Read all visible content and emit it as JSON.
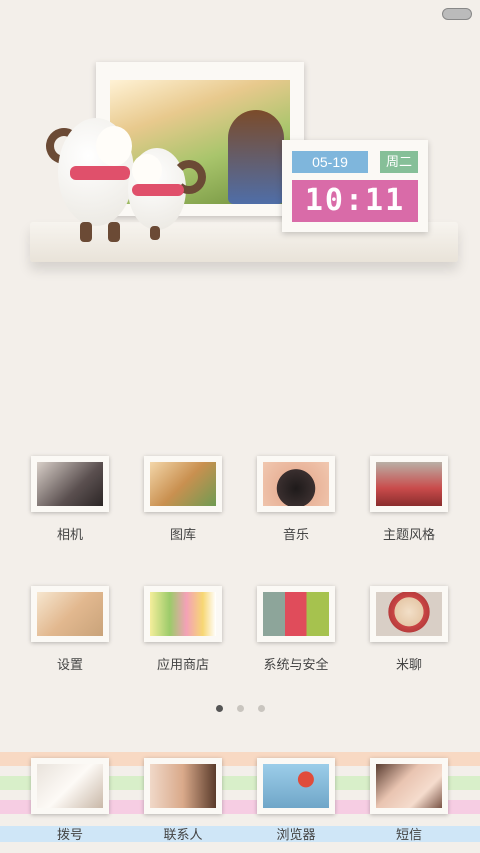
{
  "widget": {
    "date": "05-19",
    "weekday": "周二",
    "time": "10:11"
  },
  "apps_row1": [
    {
      "label": "相机"
    },
    {
      "label": "图库"
    },
    {
      "label": "音乐"
    },
    {
      "label": "主题风格"
    }
  ],
  "apps_row2": [
    {
      "label": "设置"
    },
    {
      "label": "应用商店"
    },
    {
      "label": "系统与安全"
    },
    {
      "label": "米聊"
    }
  ],
  "dock": [
    {
      "label": "拨号"
    },
    {
      "label": "联系人"
    },
    {
      "label": "浏览器"
    },
    {
      "label": "短信"
    }
  ],
  "page_indicator": {
    "total": 3,
    "current": 1
  },
  "colors": {
    "date_badge": "#7fb6dc",
    "weekday_badge": "#86bf98",
    "time_badge": "#d96ba8",
    "stripe_peach": "#f8d9c3",
    "stripe_green": "#d8efc9",
    "stripe_pink": "#f6cde3",
    "stripe_blue": "#cfe6f7"
  }
}
